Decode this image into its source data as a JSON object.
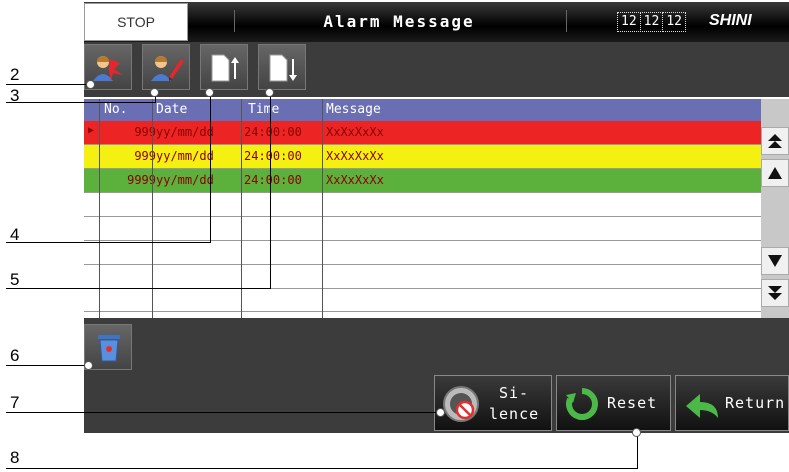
{
  "header": {
    "status": "STOP",
    "title": "Alarm Message",
    "clock": [
      "12",
      "12",
      "12"
    ],
    "logo": "SHINI"
  },
  "toolbar": {
    "buttons": [
      {
        "name": "operator-alarm-button",
        "icon": "person-alarm-icon"
      },
      {
        "name": "operator-edit-button",
        "icon": "person-pencil-icon"
      },
      {
        "name": "sort-up-button",
        "icon": "page-arrow-up-icon"
      },
      {
        "name": "sort-down-button",
        "icon": "page-arrow-down-icon"
      }
    ]
  },
  "table": {
    "columns": [
      "No.",
      "Date",
      "Time",
      "Message"
    ],
    "rows": [
      {
        "no": "999",
        "date": "yy/mm/dd",
        "time": "24:00:00",
        "message": "XxXxXxXx",
        "color": "#ec2424"
      },
      {
        "no": "999",
        "date": "yy/mm/dd",
        "time": "24:00:00",
        "message": "XxXxXxXx",
        "color": "#f4f012"
      },
      {
        "no": "9999",
        "date": "yy/mm/dd",
        "time": "24:00:00",
        "message": "XxXxXxXx",
        "color": "#5cb03c"
      }
    ],
    "text_color_active": "#8b0000",
    "selected_marker": "▶"
  },
  "buttons": {
    "silence_line1": "Si-",
    "silence_line2": "lence",
    "reset": "Reset",
    "return": "Return"
  },
  "callouts": [
    "2",
    "3",
    "4",
    "5",
    "6",
    "7",
    "8"
  ]
}
